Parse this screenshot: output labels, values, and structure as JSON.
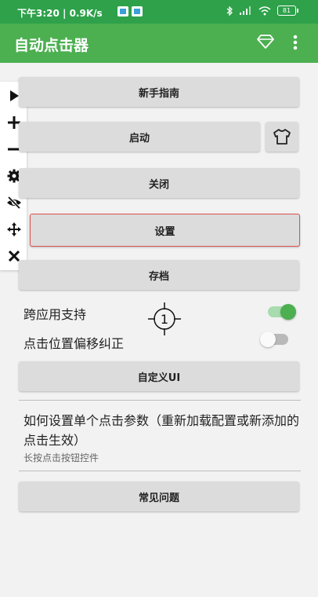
{
  "status": {
    "time": "下午3:20 | 0.9K/s",
    "battery": "81"
  },
  "appbar": {
    "title": "自动点击器"
  },
  "colors": {
    "statusbar": "#2ea14a",
    "appbar": "#4caf50",
    "selected_border": "#e05252"
  },
  "floatbar": {
    "icons": [
      "play-icon",
      "plus-icon",
      "minus-icon",
      "gear-icon",
      "eye-off-icon",
      "move-icon",
      "close-icon"
    ]
  },
  "buttons": {
    "guide": "新手指南",
    "start": "启动",
    "close": "关闭",
    "settings": "设置",
    "save": "存档",
    "custom_ui": "自定义UI",
    "faq": "常见问题"
  },
  "toggles": {
    "cross_app": {
      "label": "跨应用支持",
      "on": true
    },
    "offset": {
      "label": "点击位置偏移纠正",
      "on": false
    }
  },
  "crosshair": {
    "number": "1"
  },
  "howto": {
    "title": "如何设置单个点击参数（重新加载配置或新添加的点击生效）",
    "subtitle": "长按点击按钮控件"
  }
}
